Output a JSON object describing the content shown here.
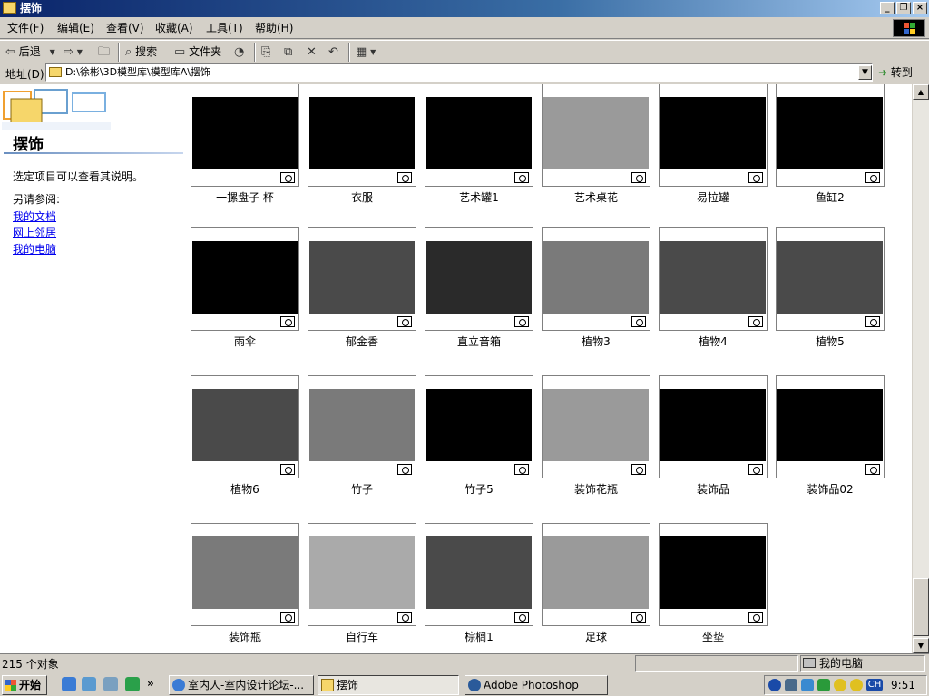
{
  "window": {
    "title": "摆饰",
    "buttons": [
      "_",
      "❐",
      "×"
    ]
  },
  "menu": [
    {
      "label": "文件(F)"
    },
    {
      "label": "编辑(E)"
    },
    {
      "label": "查看(V)"
    },
    {
      "label": "收藏(A)"
    },
    {
      "label": "工具(T)"
    },
    {
      "label": "帮助(H)"
    }
  ],
  "toolbar": {
    "back_label": "后退",
    "search_label": "搜索",
    "folders_label": "文件夹"
  },
  "address": {
    "label": "地址(D)",
    "path": "D:\\徐彬\\3D模型库\\模型库A\\摆饰",
    "go_label": "转到"
  },
  "sidebar": {
    "title": "摆饰",
    "description": "选定项目可以查看其说明。",
    "see_also": "另请参阅:",
    "links": [
      "我的文档",
      "网上邻居",
      "我的电脑"
    ]
  },
  "files": [
    {
      "name": "一摞盘子 杯",
      "bg": "#000000"
    },
    {
      "name": "衣服",
      "bg": "#000000"
    },
    {
      "name": "艺术罐1",
      "bg": "#000000"
    },
    {
      "name": "艺术桌花",
      "bg": "#9a9a9a"
    },
    {
      "name": "易拉罐",
      "bg": "#000000"
    },
    {
      "name": "鱼缸2",
      "bg": "#000000"
    },
    {
      "name": "雨伞",
      "bg": "#000000"
    },
    {
      "name": "郁金香",
      "bg": "#4a4a4a"
    },
    {
      "name": "直立音箱",
      "bg": "#2a2a2a"
    },
    {
      "name": "植物3",
      "bg": "#7a7a7a"
    },
    {
      "name": "植物4",
      "bg": "#4a4a4a"
    },
    {
      "name": "植物5",
      "bg": "#4a4a4a"
    },
    {
      "name": "植物6",
      "bg": "#4a4a4a"
    },
    {
      "name": "竹子",
      "bg": "#7a7a7a"
    },
    {
      "name": "竹子5",
      "bg": "#000000"
    },
    {
      "name": "装饰花瓶",
      "bg": "#9a9a9a"
    },
    {
      "name": "装饰品",
      "bg": "#000000"
    },
    {
      "name": "装饰品02",
      "bg": "#000000"
    },
    {
      "name": "装饰瓶",
      "bg": "#7a7a7a"
    },
    {
      "name": "自行车",
      "bg": "#aaaaaa"
    },
    {
      "name": "棕榈1",
      "bg": "#4a4a4a"
    },
    {
      "name": "足球",
      "bg": "#9a9a9a"
    },
    {
      "name": "坐垫",
      "bg": "#000000"
    }
  ],
  "status": {
    "count": "215 个对象",
    "location": "我的电脑"
  },
  "taskbar": {
    "start_label": "开始",
    "chevron": "»",
    "tasks": [
      {
        "label": "室内人-室内设计论坛-..."
      },
      {
        "label": "摆饰"
      },
      {
        "label": "Adobe Photoshop"
      }
    ],
    "lang": "CH",
    "clock": "9:51"
  }
}
